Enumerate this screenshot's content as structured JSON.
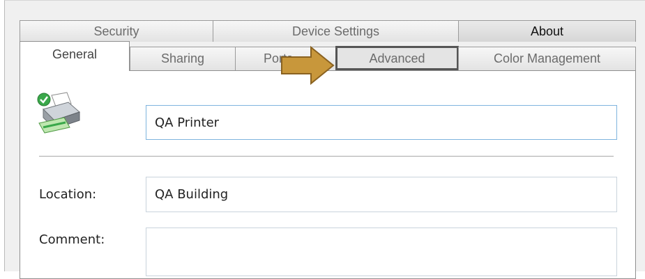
{
  "tabs": {
    "row_back": [
      {
        "label": "Security"
      },
      {
        "label": "Device Settings"
      },
      {
        "label": "About"
      }
    ],
    "row_front": [
      {
        "label": "General",
        "selected": true
      },
      {
        "label": "Sharing"
      },
      {
        "label": "Ports"
      },
      {
        "label": "Advanced",
        "highlighted": true
      },
      {
        "label": "Color Management"
      }
    ]
  },
  "annotation": {
    "icon": "arrow-right-icon",
    "color": "#c8973b",
    "points_to": "Advanced"
  },
  "general": {
    "printer_icon": "printer-ready-icon",
    "printer_name": "QA Printer",
    "location_label": "Location:",
    "location_value": "QA Building",
    "comment_label": "Comment:",
    "comment_value": ""
  },
  "colors": {
    "focus_border": "#7fb4de",
    "status_ok": "#3aa84a",
    "arrow_fill": "#c8973b"
  }
}
